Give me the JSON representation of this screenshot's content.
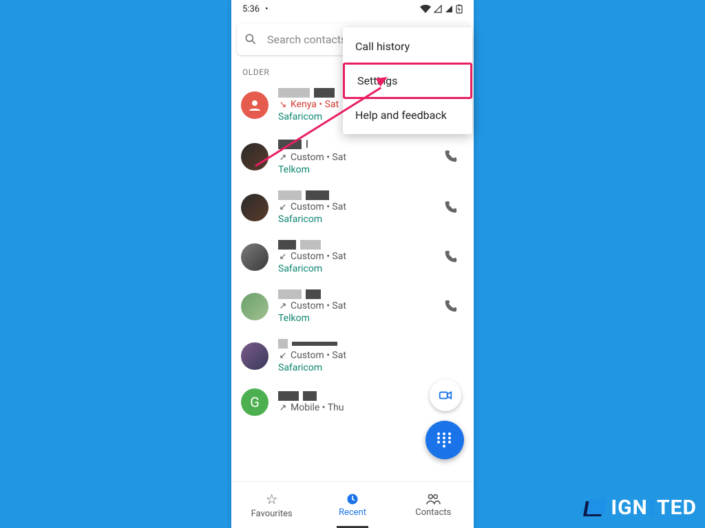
{
  "status": {
    "time": "5:36",
    "dot": "•"
  },
  "search": {
    "placeholder": "Search contacts a"
  },
  "section": {
    "older": "OLDER"
  },
  "menu": {
    "call_history": "Call history",
    "settings": "Settings",
    "help": "Help and feedback"
  },
  "entries": [
    {
      "direction": "missed",
      "meta": "Kenya • Sat",
      "carrier": "Safaricom",
      "name_suffix": ""
    },
    {
      "direction": "out",
      "meta": "Custom • Sat",
      "carrier": "Telkom",
      "name_suffix": "l"
    },
    {
      "direction": "in",
      "meta": "Custom • Sat",
      "carrier": "Safaricom",
      "name_suffix": ""
    },
    {
      "direction": "in",
      "meta": "Custom • Sat",
      "carrier": "Safaricom",
      "name_suffix": ""
    },
    {
      "direction": "out",
      "meta": "Custom • Sat",
      "carrier": "Telkom",
      "name_suffix": ""
    },
    {
      "direction": "in",
      "meta": "Custom • Sat",
      "carrier": "Safaricom",
      "name_suffix": ""
    },
    {
      "direction": "out",
      "meta": "Mobile • Thu",
      "carrier": "",
      "name_suffix": "",
      "letter": "G"
    }
  ],
  "nav": {
    "favourites": "Favourites",
    "recent": "Recent",
    "contacts": "Contacts"
  },
  "watermark": {
    "text": "IGN",
    "text2": "TED"
  }
}
